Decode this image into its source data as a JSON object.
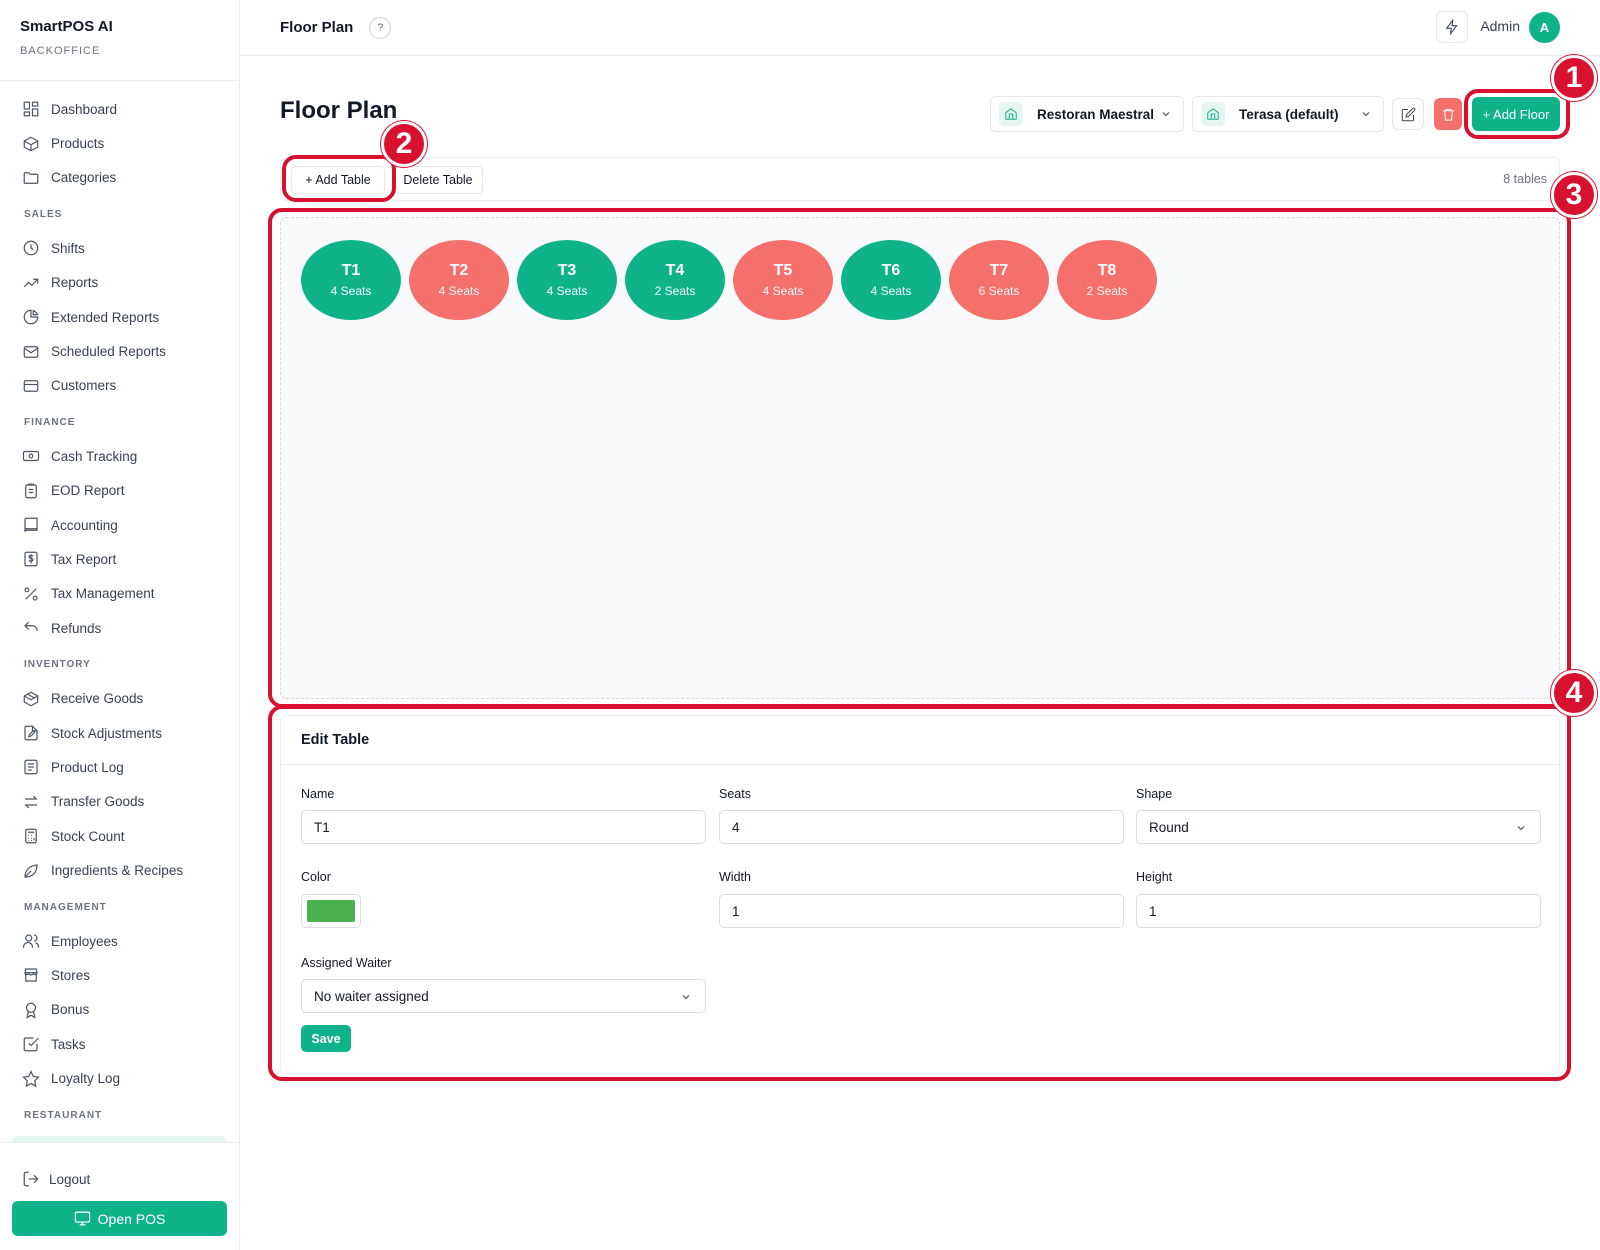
{
  "brand": {
    "title": "SmartPOS AI",
    "subtitle": "BACKOFFICE"
  },
  "sidebar": {
    "items_top": [
      {
        "label": "Dashboard",
        "icon": "dashboard-icon"
      },
      {
        "label": "Products",
        "icon": "box-icon"
      },
      {
        "label": "Categories",
        "icon": "folder-icon"
      }
    ],
    "sections": [
      {
        "title": "SALES",
        "items": [
          {
            "label": "Shifts",
            "icon": "clock-icon"
          },
          {
            "label": "Reports",
            "icon": "trend-icon"
          },
          {
            "label": "Extended Reports",
            "icon": "pie-icon"
          },
          {
            "label": "Scheduled Reports",
            "icon": "mail-icon"
          },
          {
            "label": "Customers",
            "icon": "card-icon"
          }
        ]
      },
      {
        "title": "FINANCE",
        "items": [
          {
            "label": "Cash Tracking",
            "icon": "cash-icon"
          },
          {
            "label": "EOD Report",
            "icon": "clipboard-icon"
          },
          {
            "label": "Accounting",
            "icon": "book-icon"
          },
          {
            "label": "Tax Report",
            "icon": "dollar-doc-icon"
          },
          {
            "label": "Tax Management",
            "icon": "percent-icon"
          },
          {
            "label": "Refunds",
            "icon": "undo-icon"
          }
        ]
      },
      {
        "title": "INVENTORY",
        "items": [
          {
            "label": "Receive Goods",
            "icon": "package-icon"
          },
          {
            "label": "Stock Adjustments",
            "icon": "edit-doc-icon"
          },
          {
            "label": "Product Log",
            "icon": "log-icon"
          },
          {
            "label": "Transfer Goods",
            "icon": "transfer-icon"
          },
          {
            "label": "Stock Count",
            "icon": "calculator-icon"
          },
          {
            "label": "Ingredients & Recipes",
            "icon": "leaf-icon"
          }
        ]
      },
      {
        "title": "MANAGEMENT",
        "items": [
          {
            "label": "Employees",
            "icon": "users-icon"
          },
          {
            "label": "Stores",
            "icon": "store-icon"
          },
          {
            "label": "Bonus",
            "icon": "award-icon"
          },
          {
            "label": "Tasks",
            "icon": "check-square-icon"
          },
          {
            "label": "Loyalty Log",
            "icon": "star-icon"
          }
        ]
      },
      {
        "title": "RESTAURANT",
        "items": []
      }
    ],
    "logout": "Logout",
    "open_pos": "Open POS"
  },
  "topbar": {
    "title": "Floor Plan",
    "help": "?",
    "user": "Admin",
    "avatar": "A"
  },
  "page": {
    "title": "Floor Plan",
    "store_select": "Restoran Maestral",
    "floor_select": "Terasa (default)",
    "add_floor": "+ Add Floor"
  },
  "toolbar": {
    "add_table": "+ Add Table",
    "delete_table": "Delete Table",
    "count": "8 tables"
  },
  "tables": [
    {
      "name": "T1",
      "seats": "4 Seats",
      "status": "available"
    },
    {
      "name": "T2",
      "seats": "4 Seats",
      "status": "occupied"
    },
    {
      "name": "T3",
      "seats": "4 Seats",
      "status": "available"
    },
    {
      "name": "T4",
      "seats": "2 Seats",
      "status": "available"
    },
    {
      "name": "T5",
      "seats": "4 Seats",
      "status": "occupied"
    },
    {
      "name": "T6",
      "seats": "4 Seats",
      "status": "available"
    },
    {
      "name": "T7",
      "seats": "6 Seats",
      "status": "occupied"
    },
    {
      "name": "T8",
      "seats": "2 Seats",
      "status": "occupied"
    }
  ],
  "edit": {
    "title": "Edit Table",
    "name_label": "Name",
    "name_value": "T1",
    "seats_label": "Seats",
    "seats_value": "4",
    "shape_label": "Shape",
    "shape_value": "Round",
    "color_label": "Color",
    "color_value": "#4caf50",
    "width_label": "Width",
    "width_value": "1",
    "height_label": "Height",
    "height_value": "1",
    "waiter_label": "Assigned Waiter",
    "waiter_value": "No waiter assigned",
    "save": "Save"
  },
  "annotations": [
    "1",
    "2",
    "3",
    "4"
  ],
  "colors": {
    "accent": "#10b28a",
    "available": "#10b28a",
    "occupied": "#f5706b",
    "highlight": "#d7112f"
  }
}
